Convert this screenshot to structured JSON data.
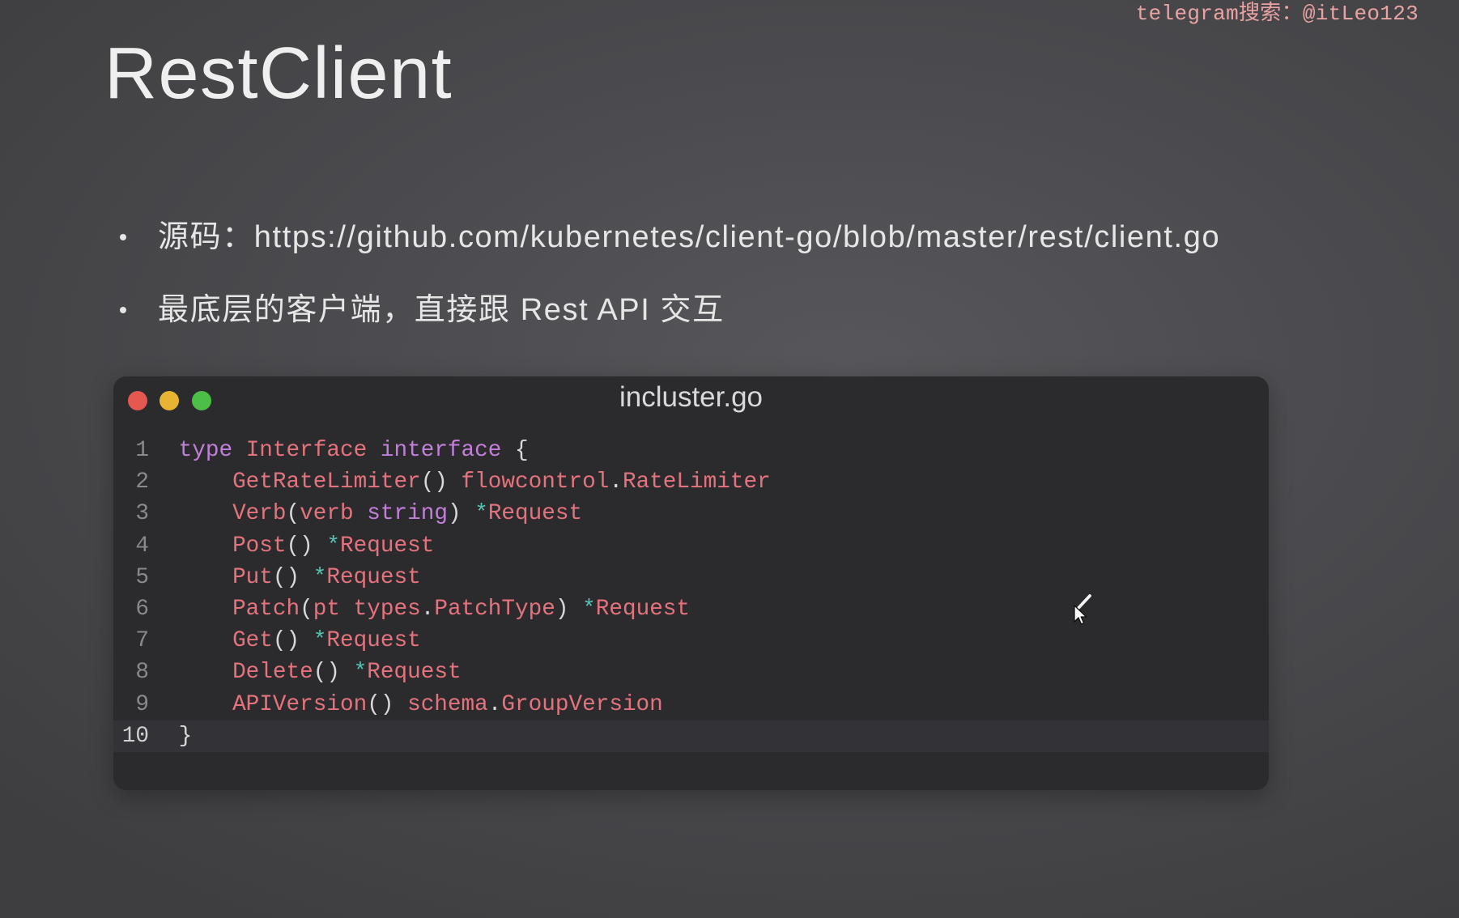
{
  "watermark": "telegram搜索：@itLeo123",
  "slide": {
    "title": "RestClient",
    "bullets": [
      "源码：https://github.com/kubernetes/client-go/blob/master/rest/client.go",
      "最底层的客户端，直接跟 Rest API 交互"
    ]
  },
  "code_window": {
    "title": "incluster.go",
    "active_line": 10,
    "lines": [
      {
        "number": "1",
        "tokens": [
          {
            "text": "type",
            "type": "keyword"
          },
          {
            "text": " ",
            "type": "punct"
          },
          {
            "text": "Interface",
            "type": "name"
          },
          {
            "text": " ",
            "type": "punct"
          },
          {
            "text": "interface",
            "type": "keyword"
          },
          {
            "text": " {",
            "type": "punct"
          }
        ]
      },
      {
        "number": "2",
        "tokens": [
          {
            "text": "    ",
            "type": "punct"
          },
          {
            "text": "GetRateLimiter",
            "type": "name"
          },
          {
            "text": "() ",
            "type": "punct"
          },
          {
            "text": "flowcontrol",
            "type": "name"
          },
          {
            "text": ".",
            "type": "punct"
          },
          {
            "text": "RateLimiter",
            "type": "name"
          }
        ]
      },
      {
        "number": "3",
        "tokens": [
          {
            "text": "    ",
            "type": "punct"
          },
          {
            "text": "Verb",
            "type": "name"
          },
          {
            "text": "(",
            "type": "punct"
          },
          {
            "text": "verb",
            "type": "name"
          },
          {
            "text": " ",
            "type": "punct"
          },
          {
            "text": "string",
            "type": "keyword"
          },
          {
            "text": ") ",
            "type": "punct"
          },
          {
            "text": "*",
            "type": "operator"
          },
          {
            "text": "Request",
            "type": "name"
          }
        ]
      },
      {
        "number": "4",
        "tokens": [
          {
            "text": "    ",
            "type": "punct"
          },
          {
            "text": "Post",
            "type": "name"
          },
          {
            "text": "() ",
            "type": "punct"
          },
          {
            "text": "*",
            "type": "operator"
          },
          {
            "text": "Request",
            "type": "name"
          }
        ]
      },
      {
        "number": "5",
        "tokens": [
          {
            "text": "    ",
            "type": "punct"
          },
          {
            "text": "Put",
            "type": "name"
          },
          {
            "text": "() ",
            "type": "punct"
          },
          {
            "text": "*",
            "type": "operator"
          },
          {
            "text": "Request",
            "type": "name"
          }
        ]
      },
      {
        "number": "6",
        "tokens": [
          {
            "text": "    ",
            "type": "punct"
          },
          {
            "text": "Patch",
            "type": "name"
          },
          {
            "text": "(",
            "type": "punct"
          },
          {
            "text": "pt",
            "type": "name"
          },
          {
            "text": " ",
            "type": "punct"
          },
          {
            "text": "types",
            "type": "name"
          },
          {
            "text": ".",
            "type": "punct"
          },
          {
            "text": "PatchType",
            "type": "name"
          },
          {
            "text": ") ",
            "type": "punct"
          },
          {
            "text": "*",
            "type": "operator"
          },
          {
            "text": "Request",
            "type": "name"
          }
        ]
      },
      {
        "number": "7",
        "tokens": [
          {
            "text": "    ",
            "type": "punct"
          },
          {
            "text": "Get",
            "type": "name"
          },
          {
            "text": "() ",
            "type": "punct"
          },
          {
            "text": "*",
            "type": "operator"
          },
          {
            "text": "Request",
            "type": "name"
          }
        ]
      },
      {
        "number": "8",
        "tokens": [
          {
            "text": "    ",
            "type": "punct"
          },
          {
            "text": "Delete",
            "type": "name"
          },
          {
            "text": "() ",
            "type": "punct"
          },
          {
            "text": "*",
            "type": "operator"
          },
          {
            "text": "Request",
            "type": "name"
          }
        ]
      },
      {
        "number": "9",
        "tokens": [
          {
            "text": "    ",
            "type": "punct"
          },
          {
            "text": "APIVersion",
            "type": "name"
          },
          {
            "text": "() ",
            "type": "punct"
          },
          {
            "text": "schema",
            "type": "name"
          },
          {
            "text": ".",
            "type": "punct"
          },
          {
            "text": "GroupVersion",
            "type": "name"
          }
        ]
      },
      {
        "number": "10",
        "tokens": [
          {
            "text": "}",
            "type": "punct"
          }
        ]
      }
    ]
  },
  "icons": {
    "window_controls": [
      "close-button",
      "minimize-button",
      "zoom-button"
    ],
    "pointer": "mouse-cursor-icon"
  },
  "colors": {
    "keyword": "#c27fd9",
    "name": "#e5737d",
    "punct": "#d8d8d8",
    "operator": "#56c2b0",
    "line_number": "#8a8a8c",
    "active_line_number": "#cfcfcf",
    "title": "#efefef",
    "text": "#e6e6e6",
    "watermark": "#e9a3a3",
    "window_bg": "#2b2b2e",
    "active_line_bg": "#333337",
    "close": "#e5584f",
    "minimize": "#e6b432",
    "zoom": "#4cbf47"
  }
}
